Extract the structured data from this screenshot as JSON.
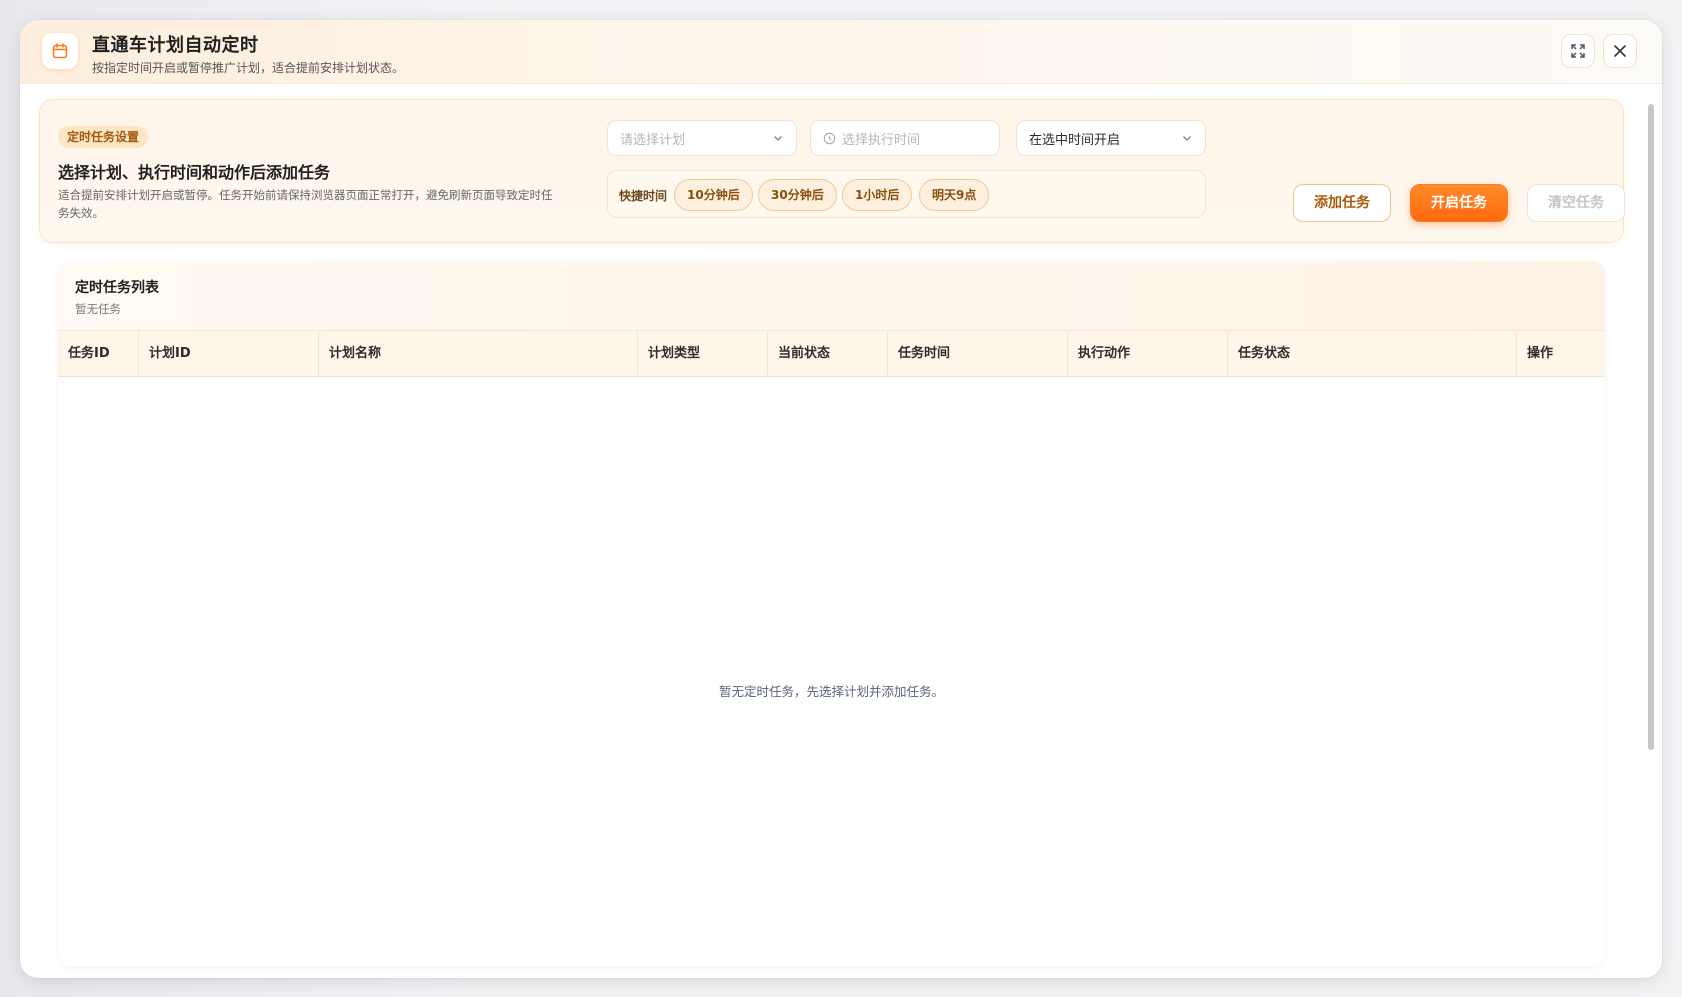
{
  "header": {
    "title": "直通车计划自动定时",
    "subtitle": "按指定时间开启或暂停推广计划，适合提前安排计划状态。",
    "icon": "calendar-icon",
    "accent": "#ff7a1a"
  },
  "settings": {
    "badge": "定时任务设置",
    "title": "选择计划、执行时间和动作后添加任务",
    "description": "适合提前安排计划开启或暂停。任务开始前请保持浏览器页面正常打开，避免刷新页面导致定时任务失效。",
    "plan_select_placeholder": "请选择计划",
    "time_picker_placeholder": "选择执行时间",
    "action_select_value": "在选中时间开启",
    "quick_label": "快捷时间",
    "quick_times": [
      "10分钟后",
      "30分钟后",
      "1小时后",
      "明天9点"
    ],
    "add_label": "添加任务",
    "start_label": "开启任务",
    "clear_label": "清空任务"
  },
  "list": {
    "title": "定时任务列表",
    "subtitle": "暂无任务",
    "columns": [
      "任务ID",
      "计划ID",
      "计划名称",
      "计划类型",
      "当前状态",
      "任务时间",
      "执行动作",
      "任务状态",
      "操作"
    ],
    "rows": [],
    "empty_text": "暂无定时任务，先选择计划并添加任务。"
  }
}
